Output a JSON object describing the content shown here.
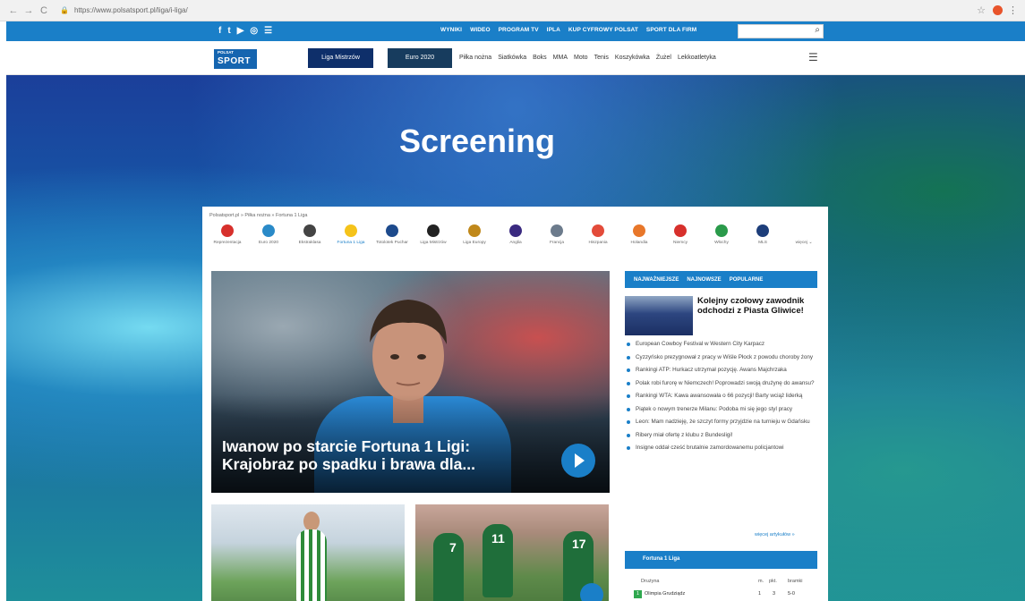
{
  "browser": {
    "url": "https://www.polsatsport.pl/liga/i-liga/"
  },
  "topbar": {
    "social_icons": [
      "f",
      "t",
      "▶",
      "◎",
      "☰"
    ],
    "links": [
      "WYNIKI",
      "WIDEO",
      "PROGRAM TV",
      "IPLA",
      "KUP CYFROWY POLSAT",
      "SPORT DLA FIRM"
    ]
  },
  "navbar": {
    "logo_small": "POLSAT",
    "logo_big": "SPORT",
    "pill_liga": "Liga Mistrzów",
    "pill_euro": "Euro 2020",
    "links": [
      "Piłka nożna",
      "Siatkówka",
      "Boks",
      "MMA",
      "Moto",
      "Tenis",
      "Koszykówka",
      "Żużel",
      "Lekkoatletyka"
    ]
  },
  "hero": {
    "headline": "Screening"
  },
  "panel": {
    "breadcrumb": "Polsatsport.pl  »  Piłka nożna  »  Fortuna 1 Liga",
    "leagues": [
      {
        "label": "Reprezentacja",
        "color": "#d7302c"
      },
      {
        "label": "Euro 2020",
        "color": "#2a8ac8"
      },
      {
        "label": "Ekstraklasa",
        "color": "#444444"
      },
      {
        "label": "Fortuna 1 Liga",
        "color": "#f5c31a",
        "active": true
      },
      {
        "label": "Totolotek Puchar",
        "color": "#1d4a8c"
      },
      {
        "label": "Liga Mistrzów",
        "color": "#222222"
      },
      {
        "label": "Liga Europy",
        "color": "#c0881a"
      },
      {
        "label": "Anglia",
        "color": "#3a2a80"
      },
      {
        "label": "Francja",
        "color": "#6c7b8c"
      },
      {
        "label": "Hiszpania",
        "color": "#e34b3a"
      },
      {
        "label": "Holandia",
        "color": "#e8772a"
      },
      {
        "label": "Niemcy",
        "color": "#d7302c"
      },
      {
        "label": "Włochy",
        "color": "#2a9a4a"
      },
      {
        "label": "MLS",
        "color": "#1d3e7a"
      },
      {
        "label": "więcej ⌄",
        "color": "#ffffff"
      }
    ],
    "main_article": {
      "title": "Iwanow po starcie Fortuna 1 Ligi: Krajobraz po spadku i brawa dla..."
    },
    "thumb2_numbers": [
      "7",
      "11",
      "17"
    ],
    "sidebar": {
      "tabs": [
        "NAJWAŻNIEJSZE",
        "NAJNOWSZE",
        "POPULARNE"
      ],
      "featured_title": "Kolejny czołowy zawodnik odchodzi z Piasta Gliwice!",
      "news": [
        "European Cowboy Festival w Western City Karpacz",
        "Cyzzyńsko prezygnował z pracy w Wiśle Płock z powodu choroby żony",
        "Rankingi ATP: Hurkacz utrzymał pozycję. Awans Majchrzaka",
        "Polak robi furorę w Niemczech! Poprowadzi swoją drużynę do awansu?",
        "Rankingi WTA: Kawa awansowała o 66 pozycji! Barty wciąż liderką",
        "Piątek o nowym trenerze Milanu: Podoba mi się jego styl pracy",
        "Leon: Mam nadzieję, że szczyt formy przyjdzie na turnieju w Gdańsku",
        "Ribery miał ofertę z klubu z Bundesligi!",
        "Insigne oddał cześć brutalnie zamordowanemu policjantowi"
      ],
      "more_link": "więcej artykułów »",
      "table_title": "Fortuna 1 Liga",
      "table_headers": {
        "team": "Drużyna",
        "m": "m.",
        "pkt": "pkt.",
        "bramki": "bramki"
      },
      "table_rows": [
        {
          "pos": "1",
          "team": "Olimpia Grudziądz",
          "m": "1",
          "pkt": "3",
          "bramki": "5-0"
        }
      ]
    }
  }
}
